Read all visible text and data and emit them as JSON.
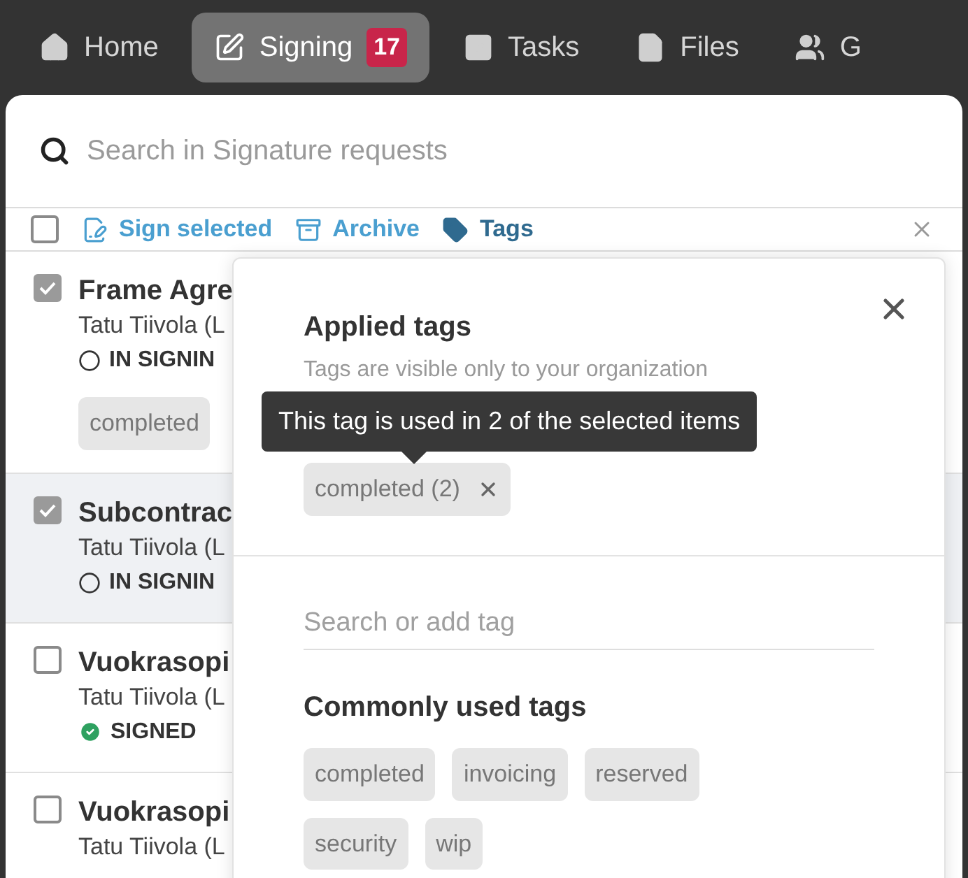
{
  "nav": [
    {
      "label": "Home",
      "selected": false
    },
    {
      "label": "Signing",
      "selected": true,
      "badge": "17"
    },
    {
      "label": "Tasks",
      "selected": false
    },
    {
      "label": "Files",
      "selected": false
    },
    {
      "label": "G",
      "selected": false
    }
  ],
  "search": {
    "placeholder": "Search in Signature requests"
  },
  "toolbar": {
    "select_all": {
      "checked": false
    },
    "actions": [
      {
        "label": "Sign selected",
        "kind": "light"
      },
      {
        "label": "Archive",
        "kind": "light"
      },
      {
        "label": "Tags",
        "kind": "dark"
      }
    ]
  },
  "rows": [
    {
      "title": "Frame Agre",
      "signer": "Tatu Tiivola (L",
      "status": "IN SIGNIN",
      "kind": "in_signing",
      "checked": true,
      "selected": false,
      "tags": [
        "completed"
      ]
    },
    {
      "title": "Subcontrac",
      "signer": "Tatu Tiivola (L",
      "status": "IN SIGNIN",
      "kind": "in_signing",
      "checked": true,
      "selected": true,
      "tags": []
    },
    {
      "title": "Vuokrasopi",
      "signer": "Tatu Tiivola (L",
      "status": "SIGNED",
      "kind": "signed",
      "checked": false,
      "selected": false,
      "tags": []
    },
    {
      "title": "Vuokrasopi",
      "signer": "Tatu Tiivola (L",
      "kind": "none",
      "checked": false,
      "selected": false,
      "tags": []
    }
  ],
  "tags_panel": {
    "title": "Applied tags",
    "subtitle": "Tags are visible only to your organization",
    "applied": [
      {
        "label": "completed (2)"
      }
    ],
    "tooltip": "This tag is used in 2 of the selected items",
    "search_placeholder": "Search or add tag",
    "common_title": "Commonly used tags",
    "common": [
      "completed",
      "invoicing",
      "reserved",
      "security",
      "wip"
    ]
  }
}
